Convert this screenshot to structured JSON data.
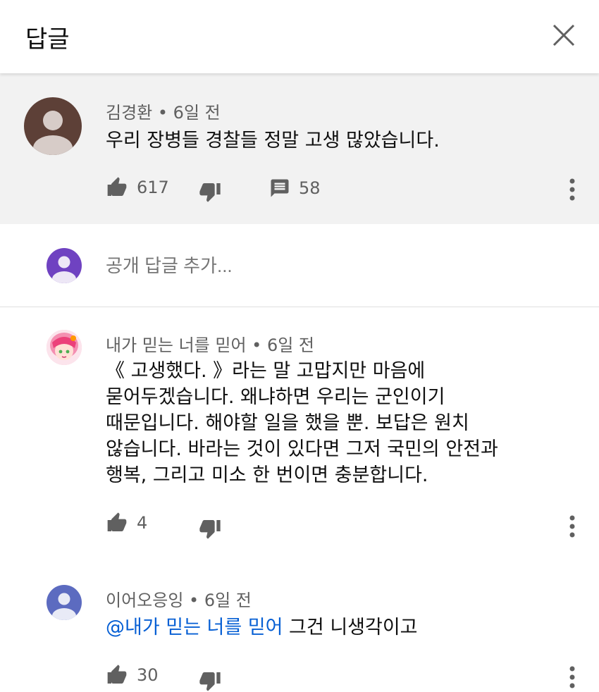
{
  "header": {
    "title": "답글",
    "close_icon": "close-icon"
  },
  "parent_comment": {
    "author": "김경환",
    "time": "6일 전",
    "text": "우리 장병들 경찰들 정말 고생 많았습니다.",
    "likes": "617",
    "replies": "58",
    "avatar_color": "#5d4037"
  },
  "add_reply": {
    "placeholder": "공개 답글 추가..."
  },
  "replies": [
    {
      "author": "내가 믿는 너를 믿어",
      "time": "6일 전",
      "lines": [
        "《 고생했다. 》라는 말 고맙지만 마음에",
        "묻어두겠습니다. 왜냐하면 우리는 군인이기",
        "때문입니다. 해야할 일을 했을 뿐. 보답은 원치",
        "않습니다. 바라는 것이 있다면 그저 국민의 안전과",
        "행복, 그리고 미소 한 번이면 충분합니다."
      ],
      "likes": "4"
    },
    {
      "author": "이어오응잉",
      "time": "6일 전",
      "mention": "@내가 믿는 너를 믿어",
      "text": " 그건 니생각이고",
      "likes": "30"
    }
  ],
  "separator": " • ",
  "colors": {
    "mention": "#065fd4",
    "avatar_purple": "#6f42c1",
    "avatar_blue": "#5c6bc0"
  }
}
